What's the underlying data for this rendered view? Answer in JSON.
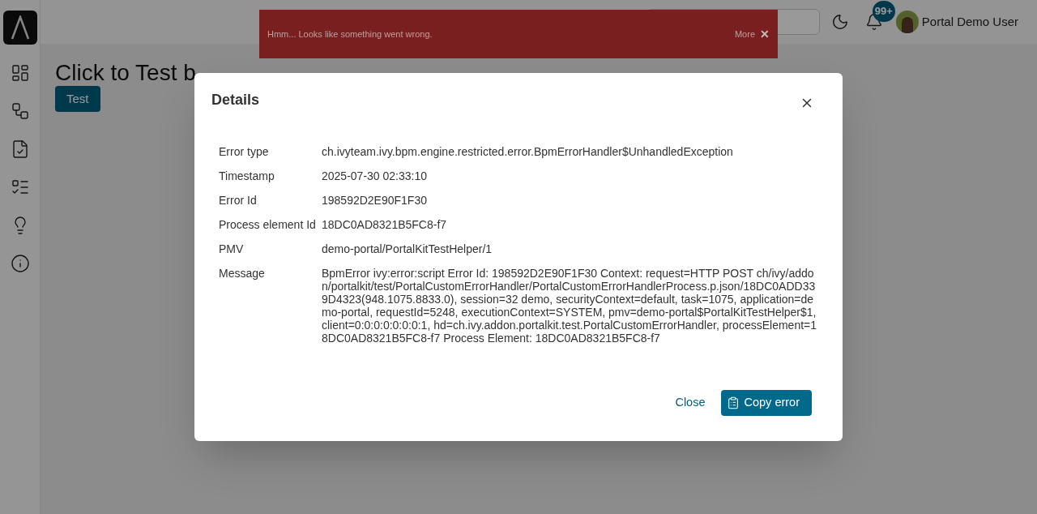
{
  "header": {
    "notifications_badge": "99+",
    "user_name": "Portal Demo User"
  },
  "sidebar": {
    "items": [
      {
        "kind": "dashboard"
      },
      {
        "kind": "processes"
      },
      {
        "kind": "tasks"
      },
      {
        "kind": "cases"
      },
      {
        "kind": "ideas"
      },
      {
        "kind": "about"
      }
    ]
  },
  "page": {
    "heading": "Click to Test b",
    "test_button": "Test"
  },
  "toast": {
    "message": "Hmm... Looks like something went wrong.",
    "more": "More",
    "close": "✕"
  },
  "dialog": {
    "title": "Details",
    "rows": [
      {
        "label": "Error type",
        "value": "ch.ivyteam.ivy.bpm.engine.restricted.error.BpmErrorHandler$UnhandledException"
      },
      {
        "label": "Timestamp",
        "value": "2025-07-30 02:33:10"
      },
      {
        "label": "Error Id",
        "value": "198592D2E90F1F30"
      },
      {
        "label": "Process element Id",
        "value": "18DC0AD8321B5FC8-f7"
      },
      {
        "label": "PMV",
        "value": "demo-portal/PortalKitTestHelper/1"
      },
      {
        "label": "Message",
        "value": "BpmError ivy:error:script Error Id: 198592D2E90F1F30 Context: request=HTTP POST ch/ivy/addon/portalkit/test/PortalCustomErrorHandler/PortalCustomErrorHandlerProcess.p.json/18DC0ADD339D4323(948.1075.8833.0), session=32 demo, securityContext=default, task=1075, application=demo-portal, requestId=5248, executionContext=SYSTEM, pmv=demo-portal$PortalKitTestHelper$1, client=0:0:0:0:0:0:0:1, hd=ch.ivy.addon.portalkit.test.PortalCustomErrorHandler, processElement=18DC0AD8321B5FC8-f7 Process Element: 18DC0AD8321B5FC8-f7"
      }
    ],
    "close_button": "Close",
    "copy_button": "Copy error"
  }
}
